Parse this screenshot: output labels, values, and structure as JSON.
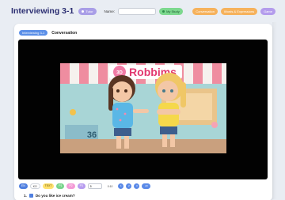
{
  "header": {
    "title": "Interviewing 3-1",
    "tutor_label": "Tutor",
    "name_label": "Name:",
    "name_value": "",
    "my_study_label": "My Study",
    "right_buttons": [
      "Conversation",
      "Words & Expressions",
      "Game"
    ]
  },
  "card": {
    "active_tab": "Interviewing 3-1",
    "section_title": "Conversation",
    "video": {
      "sign_text": "Robbims",
      "sign_prefix": "3D",
      "poster_number": "36"
    },
    "controls": {
      "en": "EN",
      "ko": "KO",
      "text": "TEXT",
      "p1": "P1",
      "p2": "P2",
      "p3": "P3",
      "speed_value": "5",
      "time": "0:10",
      "round_buttons": [
        "1",
        "2",
        "3"
      ],
      "last_button": "All"
    },
    "question": {
      "number": "1.",
      "text": "Do you like ice cream?"
    }
  }
}
